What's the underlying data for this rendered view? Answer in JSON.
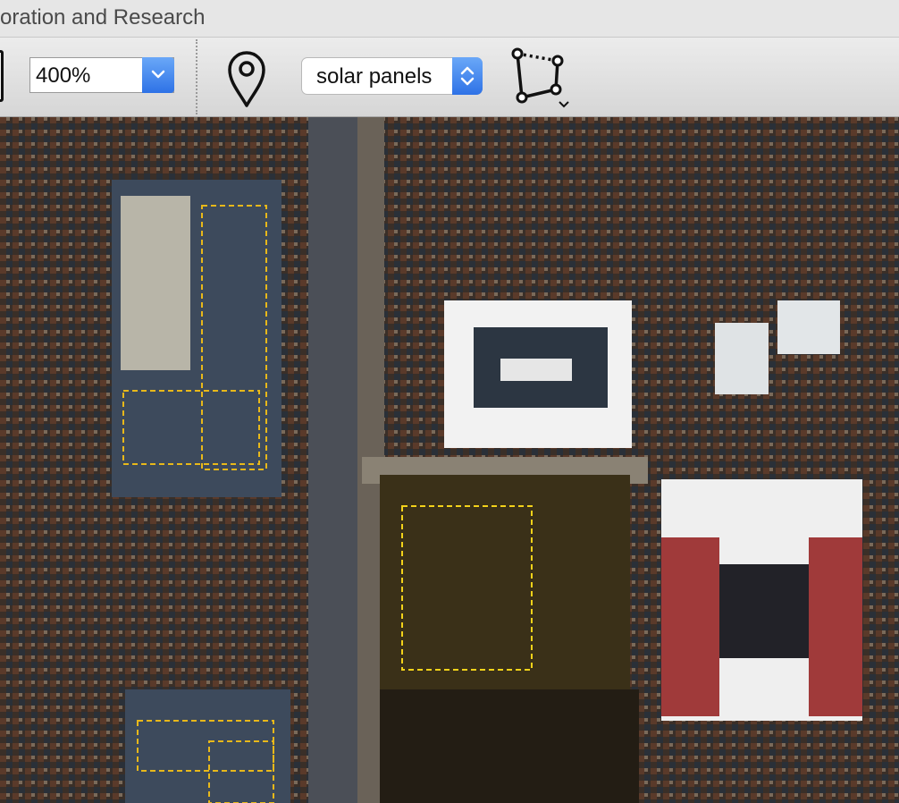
{
  "window": {
    "title": "oration and Research"
  },
  "toolbar": {
    "zoom": {
      "value": "400%"
    },
    "layer": {
      "value": "solar panels"
    }
  },
  "icons": {
    "zoom_arrow": "chevron-down-icon",
    "place": "map-pin-icon",
    "layer_arrow": "up-down-stepper-icon",
    "polygon": "polygon-draw-icon"
  },
  "annotations": {
    "stroke": "#f2c418"
  },
  "colors": {
    "accent": "#2e72e6"
  }
}
